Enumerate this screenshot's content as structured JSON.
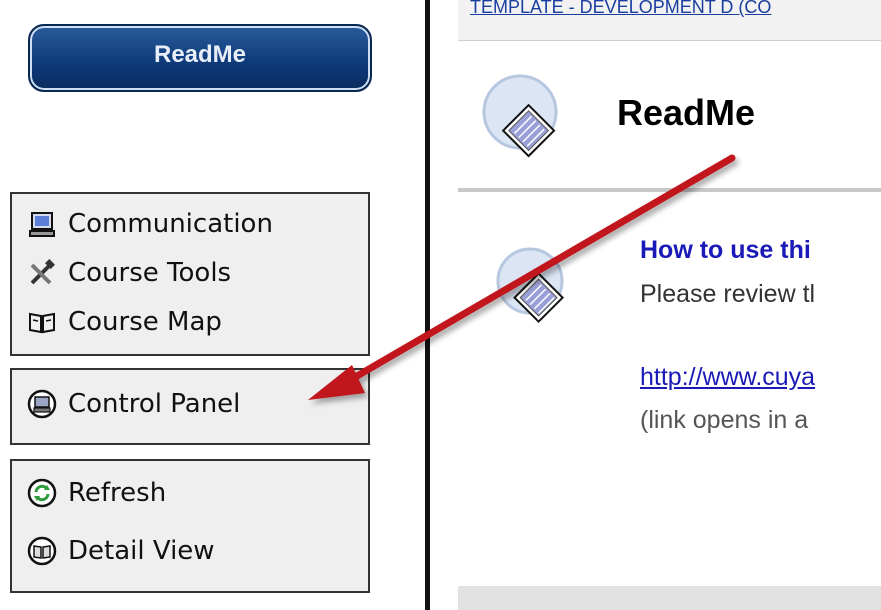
{
  "sidebar": {
    "readme_button": "ReadMe",
    "group1": [
      {
        "label": "Communication",
        "icon": "computer-icon"
      },
      {
        "label": "Course Tools",
        "icon": "tools-icon"
      },
      {
        "label": "Course Map",
        "icon": "book-map-icon"
      }
    ],
    "group2": [
      {
        "label": "Control Panel",
        "icon": "control-panel-icon"
      }
    ],
    "group3": [
      {
        "label": "Refresh",
        "icon": "refresh-icon"
      },
      {
        "label": "Detail View",
        "icon": "detail-view-icon"
      }
    ]
  },
  "content": {
    "breadcrumb": "TEMPLATE - DEVELOPMENT D (CO",
    "page_title": "ReadMe",
    "item": {
      "title": "How to use thi",
      "description": "Please review tl",
      "link": "http://www.cuya",
      "note": "(link opens in a"
    },
    "bottom_heading": ""
  },
  "colors": {
    "readme_button": "#0e3b7b",
    "panel_bg": "#efefef",
    "link_blue": "#1a1ab8",
    "arrow_red": "#c0121b"
  }
}
